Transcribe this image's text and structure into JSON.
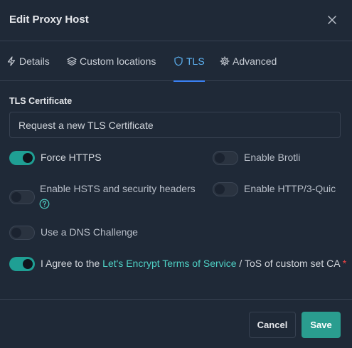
{
  "modal": {
    "title": "Edit Proxy Host",
    "close_icon": "close-icon"
  },
  "tabs": [
    {
      "label": "Details",
      "icon": "lightning-icon",
      "active": false
    },
    {
      "label": "Custom locations",
      "icon": "layers-icon",
      "active": false
    },
    {
      "label": "TLS",
      "icon": "shield-icon",
      "active": true
    },
    {
      "label": "Advanced",
      "icon": "gear-icon",
      "active": false
    }
  ],
  "tls": {
    "section_label": "TLS Certificate",
    "certificate_value": "Request a new TLS Certificate",
    "toggles": {
      "force_https": {
        "label": "Force HTTPS",
        "on": true
      },
      "enable_brotli": {
        "label": "Enable Brotli",
        "on": false
      },
      "enable_hsts": {
        "label": "Enable HSTS and security headers",
        "on": false
      },
      "enable_http3": {
        "label": "Enable HTTP/3-Quic",
        "on": false
      },
      "dns_challenge": {
        "label": "Use a DNS Challenge",
        "on": false
      },
      "agree_tos": {
        "on": true,
        "prefix": "I Agree to the ",
        "link": "Let's Encrypt Terms of Service",
        "suffix": " / ToS of custom set CA",
        "required_mark": "*"
      }
    }
  },
  "footer": {
    "cancel_label": "Cancel",
    "save_label": "Save"
  },
  "colors": {
    "background": "#1f2937",
    "accent": "#1f9f94",
    "active_tab": "#5eb4f5",
    "link": "#4fd1c5",
    "required": "#ef4444"
  }
}
